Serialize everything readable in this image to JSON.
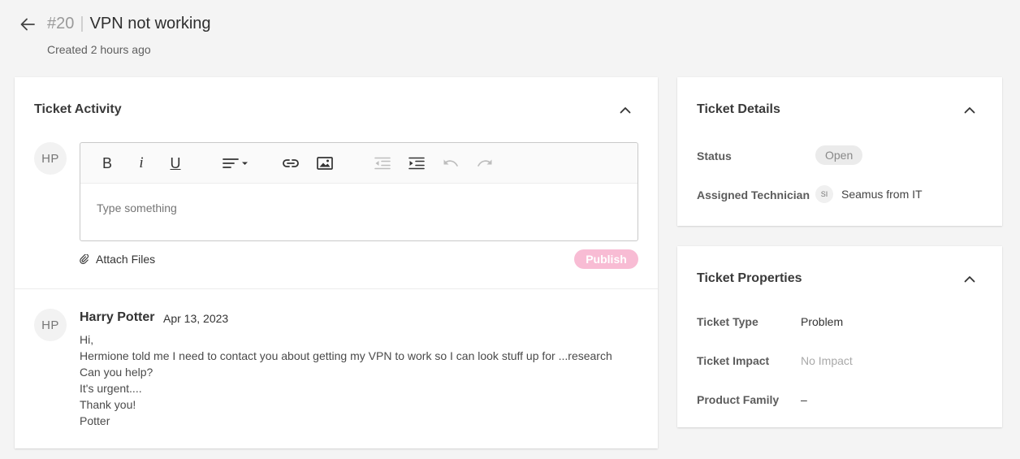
{
  "header": {
    "ticket_number": "#20",
    "separator": "|",
    "title": "VPN not working",
    "created": "Created 2 hours ago"
  },
  "activity": {
    "title": "Ticket Activity",
    "avatar_initials": "HP",
    "editor": {
      "placeholder": "Type something",
      "toolbar": [
        "bold-icon",
        "italic-icon",
        "underline-icon",
        "align-icon",
        "link-icon",
        "image-icon",
        "outdent-icon",
        "indent-icon",
        "undo-icon",
        "redo-icon"
      ],
      "bold_glyph": "B",
      "italic_glyph": "i",
      "underline_glyph": "U"
    },
    "attach_label": "Attach Files",
    "publish_label": "Publish",
    "comment": {
      "avatar_initials": "HP",
      "author": "Harry Potter",
      "date": "Apr 13, 2023",
      "lines": [
        "Hi,",
        "Hermione told me I need to contact you about getting my VPN to work so I can look stuff up for ...research",
        "Can you help?",
        "It's urgent....",
        "Thank you!",
        "Potter"
      ]
    }
  },
  "details": {
    "title": "Ticket Details",
    "status_label": "Status",
    "status_value": "Open",
    "technician_label": "Assigned Technician",
    "technician_initials": "SI",
    "technician_name": "Seamus from IT"
  },
  "properties": {
    "title": "Ticket Properties",
    "type_label": "Ticket Type",
    "type_value": "Problem",
    "impact_label": "Ticket Impact",
    "impact_value": "No Impact",
    "family_label": "Product Family",
    "family_value": "–"
  },
  "colors": {
    "publish": "#f8bcd4",
    "background": "#f4f4f4"
  }
}
